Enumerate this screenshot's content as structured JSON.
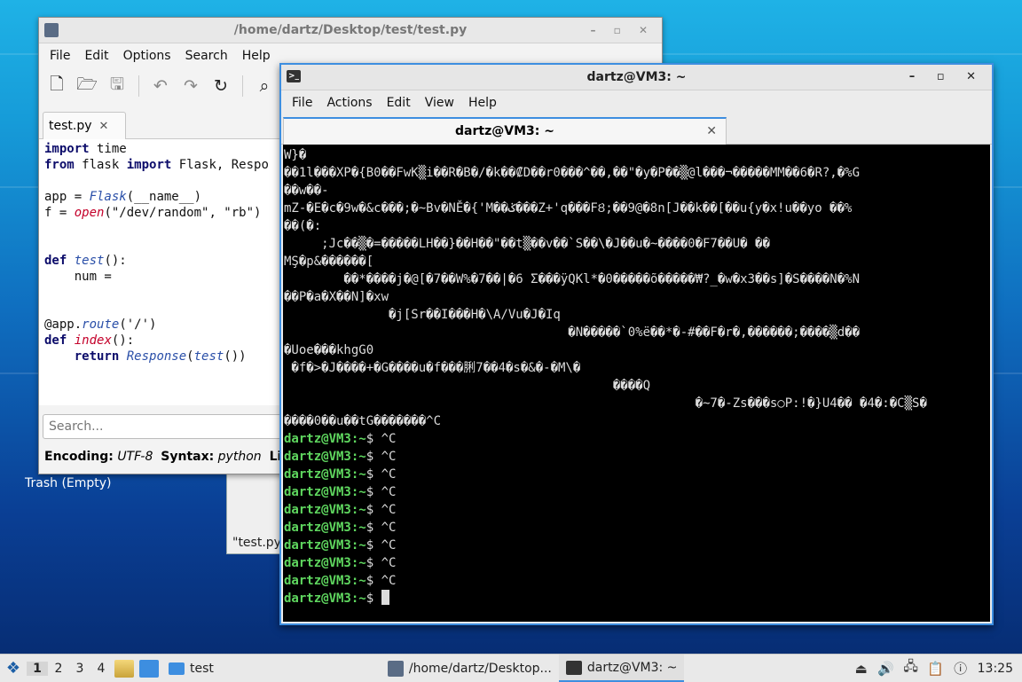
{
  "desktop": {
    "trash_label": "Trash (Empty)",
    "behind_window_text": "\"test.py"
  },
  "editor": {
    "title": "/home/dartz/Desktop/test/test.py",
    "menu": [
      "File",
      "Edit",
      "Options",
      "Search",
      "Help"
    ],
    "tab_label": "test.py",
    "code_lines": [
      [
        {
          "t": "import",
          "c": "kw"
        },
        {
          "t": " time"
        }
      ],
      [
        {
          "t": "from",
          "c": "kw"
        },
        {
          "t": " flask "
        },
        {
          "t": "import",
          "c": "kw"
        },
        {
          "t": " Flask, Respo"
        }
      ],
      [],
      [
        {
          "t": "app = "
        },
        {
          "t": "Flask",
          "c": "fn"
        },
        {
          "t": "(__name__)"
        }
      ],
      [
        {
          "t": "f = "
        },
        {
          "t": "open",
          "c": "bi"
        },
        {
          "t": "(\"/dev/random\", \"rb\")"
        }
      ],
      [],
      [],
      [
        {
          "t": "def",
          "c": "kw"
        },
        {
          "t": " "
        },
        {
          "t": "test",
          "c": "fn"
        },
        {
          "t": "():"
        }
      ],
      [
        {
          "t": "    num ="
        }
      ],
      [],
      [],
      [
        {
          "t": "@app."
        },
        {
          "t": "route",
          "c": "fn"
        },
        {
          "t": "('/')"
        }
      ],
      [
        {
          "t": "def",
          "c": "kw"
        },
        {
          "t": " "
        },
        {
          "t": "index",
          "c": "bi"
        },
        {
          "t": "():"
        }
      ],
      [
        {
          "t": "    "
        },
        {
          "t": "return",
          "c": "kw"
        },
        {
          "t": " "
        },
        {
          "t": "Response",
          "c": "fn"
        },
        {
          "t": "("
        },
        {
          "t": "test",
          "c": "fn"
        },
        {
          "t": "())"
        }
      ]
    ],
    "search_placeholder": "Search...",
    "status": {
      "encoding_label": "Encoding:",
      "encoding_value": "UTF-8",
      "syntax_label": "Syntax:",
      "syntax_value": "python",
      "lines_label": "Lines"
    }
  },
  "terminal": {
    "title": "dartz@VM3: ~",
    "menu": [
      "File",
      "Actions",
      "Edit",
      "View",
      "Help"
    ],
    "tab_label": "dartz@VM3: ~",
    "garbage_lines": [
      "W}�",
      "��1l���XP�{B0��FwK▒i��R�B�/�k��₡D��r0���^��,��\"�y�P��▒@l���¬�����MM��6�R?,�%G",
      "��w��-",
      "mZ-�E�c�9w�&c���;�~Bv�NĚ�{'M��ݢ���Z+'q���FȢ;��9@�8n[J��k��[��u{y�x!u��yo ��%",
      "��(�:",
      "     ;Jc��▒�=�����LH��}��H��\"��t▒��v��`S��\\�J��u�~����0�F7��U� ��",
      "MŞ�p&���̑���[",
      "        ��*����j�@[�7��W%�7��|�6 Σ���ÿQKl*�0�����õ�����₩?_�w�x3��s]�S����N�%N",
      "��P�a�X��N]�xw",
      "              �j[Sr��I���H�\\A/Vu�J�Iq",
      "                                      �N�����`0%ë��*�-#��F�r�,������;����▒d��",
      "�Uoe���khgG0",
      " �f�>�J����+�G����u�f���脷7��4�s�&�-�M\\�",
      "                                            ����Q",
      "                                                       �~7�-Zs���s○P:!�}U4�� �4�:�C▒S�",
      "����0��u��tG�������^C"
    ],
    "prompt_user": "dartz@VM3",
    "prompt_path": ":~",
    "prompt_symbol": "$ ",
    "interrupt_lines": [
      "^C",
      "^C",
      "^C",
      "^C",
      "^C",
      "^C",
      "^C",
      "^C",
      "^C"
    ]
  },
  "taskbar": {
    "workspaces": [
      "1",
      "2",
      "3",
      "4"
    ],
    "active_workspace": 0,
    "folder_label": "test",
    "task_editor": "/home/dartz/Desktop...",
    "task_terminal": "dartz@VM3: ~",
    "clock": "13:25"
  }
}
